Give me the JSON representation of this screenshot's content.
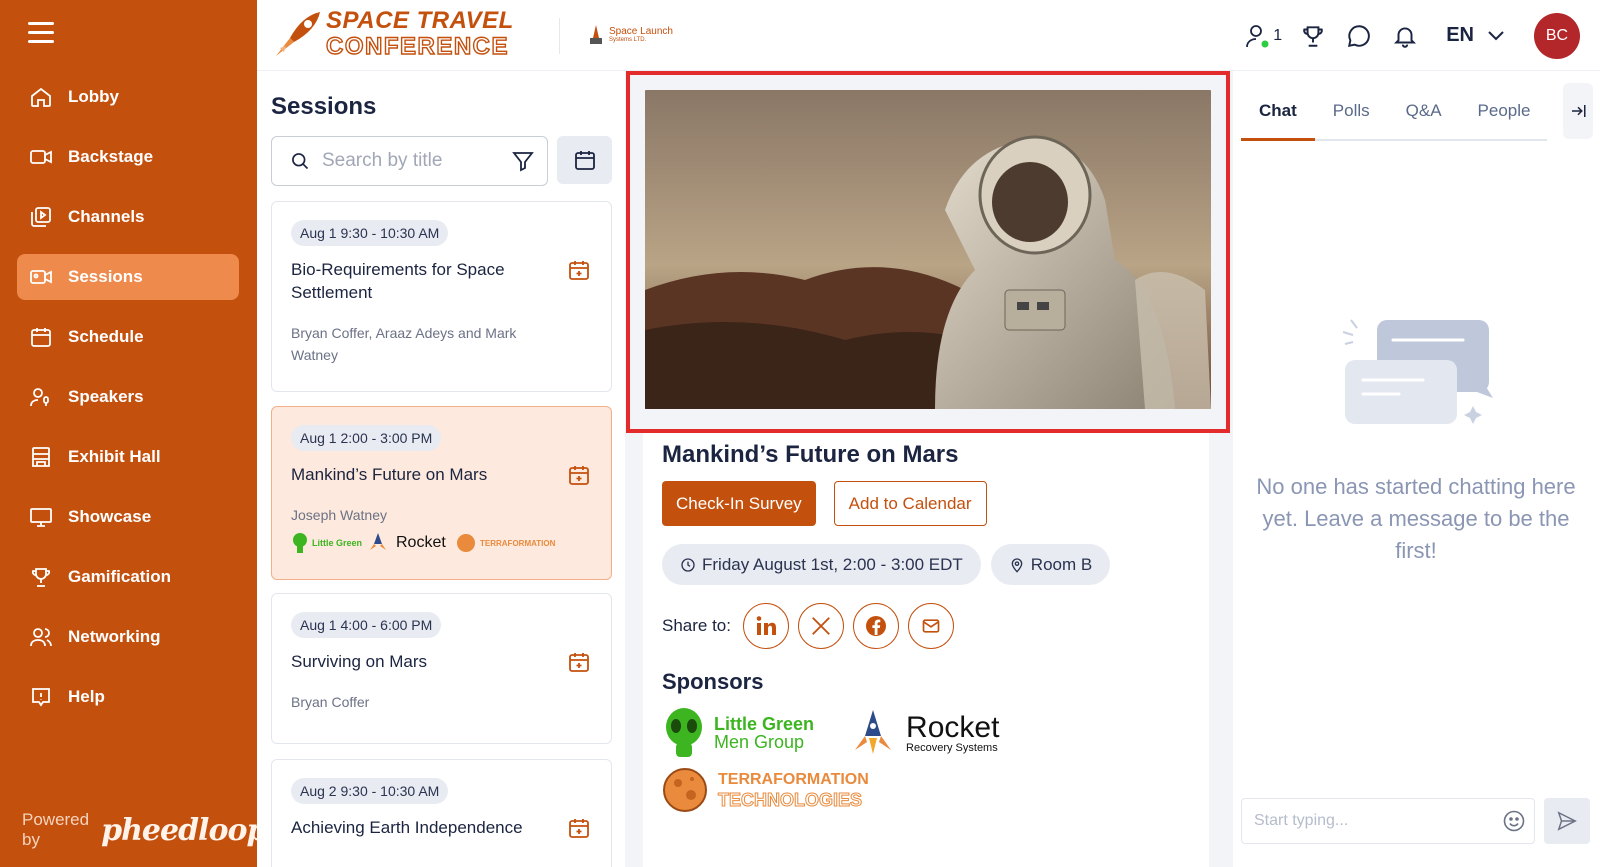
{
  "app": {
    "logo_line1": "SPACE TRAVEL",
    "logo_line2": "CONFERENCE",
    "sponsor_header_name": "Space Launch",
    "sponsor_header_sub": "Systems LTD.",
    "brand_color": "#c4500e"
  },
  "sidebar": {
    "items": [
      {
        "label": "Lobby",
        "icon": "home-icon"
      },
      {
        "label": "Backstage",
        "icon": "video-camera-icon"
      },
      {
        "label": "Channels",
        "icon": "channels-icon"
      },
      {
        "label": "Sessions",
        "icon": "video-camera-icon",
        "active": true
      },
      {
        "label": "Schedule",
        "icon": "calendar-icon"
      },
      {
        "label": "Speakers",
        "icon": "speaker-icon"
      },
      {
        "label": "Exhibit Hall",
        "icon": "booth-icon"
      },
      {
        "label": "Showcase",
        "icon": "presentation-icon"
      },
      {
        "label": "Gamification",
        "icon": "trophy-icon"
      },
      {
        "label": "Networking",
        "icon": "users-icon"
      },
      {
        "label": "Help",
        "icon": "help-icon"
      }
    ],
    "powered_by": "Powered by",
    "powered_brand": "pheedloop"
  },
  "header": {
    "online_count": "1",
    "language": "EN",
    "avatar_initials": "BC"
  },
  "sessions": {
    "title": "Sessions",
    "search_placeholder": "Search by title",
    "cards": [
      {
        "time": "Aug 1 9:30 - 10:30 AM",
        "title": "Bio-Requirements for Space Settlement",
        "speakers": "Bryan Coffer, Araaz Adeys and Mark Watney"
      },
      {
        "time": "Aug 1 2:00 - 3:00 PM",
        "title": "Mankind’s Future on Mars",
        "speakers": "Joseph Watney",
        "active": true
      },
      {
        "time": "Aug 1 4:00 - 6:00 PM",
        "title": "Surviving on Mars",
        "speakers": "Bryan Coffer"
      },
      {
        "time": "Aug 2 9:30 - 10:30 AM",
        "title": "Achieving Earth Independence",
        "speakers": ""
      }
    ]
  },
  "detail": {
    "title": "Mankind’s Future on Mars",
    "checkin_label": "Check-In Survey",
    "calendar_label": "Add to Calendar",
    "datetime": "Friday August 1st, 2:00 - 3:00 EDT",
    "room": "Room B",
    "share_label": "Share to:",
    "sponsors_heading": "Sponsors",
    "sponsors": [
      {
        "line1": "Little Green",
        "line2": "Men Group"
      },
      {
        "line1": "Rocket",
        "line2": "Recovery Systems"
      },
      {
        "line1": "TERRAFORMATION",
        "line2": "TECHNOLOGIES"
      }
    ]
  },
  "chat": {
    "tabs": [
      "Chat",
      "Polls",
      "Q&A",
      "People"
    ],
    "empty_message": "No one has started chatting here yet. Leave a message to be the first!",
    "input_placeholder": "Start typing..."
  }
}
